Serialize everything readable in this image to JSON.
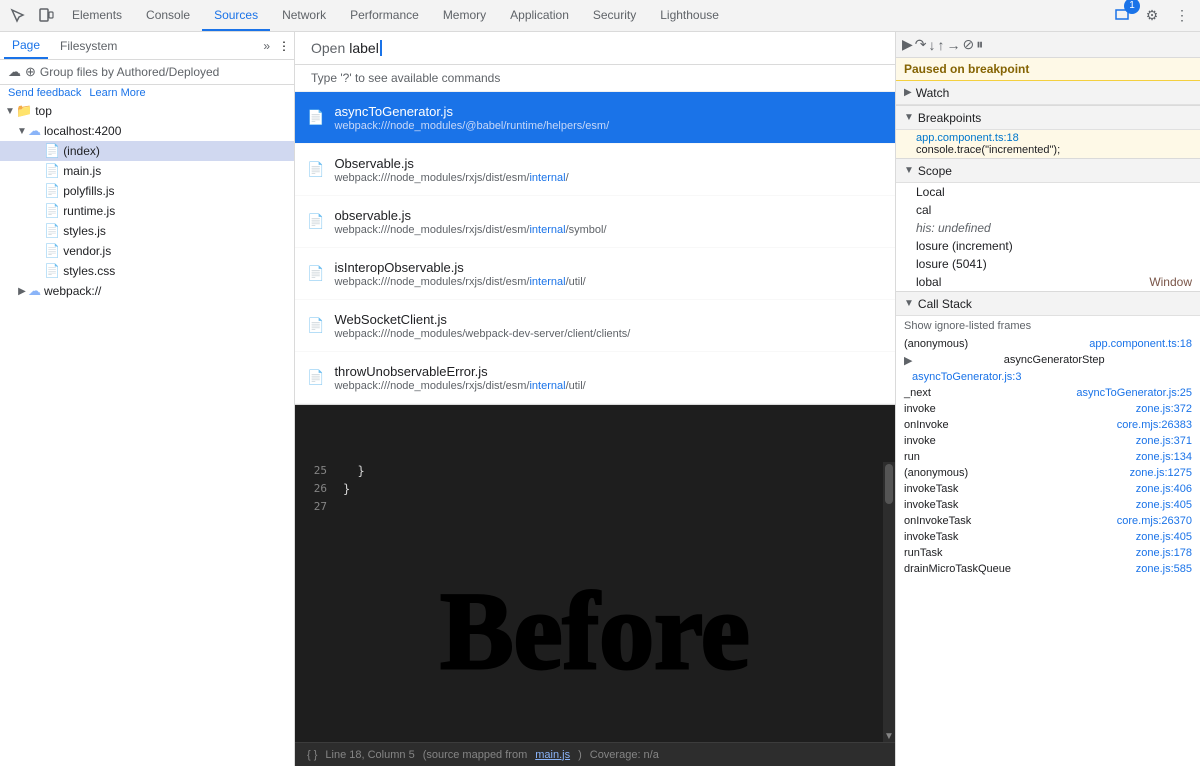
{
  "toolbar": {
    "tabs": [
      "Elements",
      "Console",
      "Sources",
      "Network",
      "Performance",
      "Memory",
      "Application",
      "Security",
      "Lighthouse"
    ],
    "activeTab": "Sources",
    "iconButtons": [
      "inspect",
      "device",
      "settings",
      "more"
    ],
    "badge": "1"
  },
  "leftPanel": {
    "subTabs": [
      "Page",
      "Filesystem"
    ],
    "activeSubTab": "Page",
    "groupLabel": "Group files by Authored/Deployed",
    "sendFeedback": "Send feedback",
    "learnMore": "Learn More",
    "tree": [
      {
        "level": 0,
        "type": "folder",
        "label": "top",
        "expanded": true
      },
      {
        "level": 1,
        "type": "cloud",
        "label": "localhost:4200",
        "expanded": true
      },
      {
        "level": 2,
        "type": "file",
        "label": "(index)",
        "selected": true
      },
      {
        "level": 2,
        "type": "js",
        "label": "main.js"
      },
      {
        "level": 2,
        "type": "js",
        "label": "polyfills.js"
      },
      {
        "level": 2,
        "type": "js",
        "label": "runtime.js"
      },
      {
        "level": 2,
        "type": "js",
        "label": "styles.js"
      },
      {
        "level": 2,
        "type": "js",
        "label": "vendor.js"
      },
      {
        "level": 2,
        "type": "css",
        "label": "styles.css"
      },
      {
        "level": 1,
        "type": "cloud",
        "label": "webpack://",
        "expanded": false
      }
    ]
  },
  "openFile": {
    "label": "Open",
    "query": "label",
    "hint": "Type '?' to see available commands",
    "results": [
      {
        "name": "asyncToGenerator.js",
        "path": "webpack:///node_modules/@babel/runtime/helpers/esm/",
        "pathHighlight": "",
        "active": true
      },
      {
        "name": "Observable.js",
        "path": "webpack:///node_modules/rxjs/dist/esm/internal/",
        "pathHighlight": "internal",
        "active": false
      },
      {
        "name": "observable.js",
        "path": "webpack:///node_modules/rxjs/dist/esm/internal/symbol/",
        "pathHighlight": "internal",
        "active": false
      },
      {
        "name": "isInteropObservable.js",
        "path": "webpack:///node_modules/rxjs/dist/esm/internal/util/",
        "pathHighlight": "internal",
        "active": false
      },
      {
        "name": "WebSocketClient.js",
        "path": "webpack:///node_modules/webpack-dev-server/client/clients/",
        "pathHighlight": "",
        "active": false
      },
      {
        "name": "throwUnobservableError.js",
        "path": "webpack:///node_modules/rxjs/dist/esm/internal/util/",
        "pathHighlight": "internal",
        "active": false
      }
    ]
  },
  "codeLines": [
    {
      "num": 25,
      "code": "  }"
    },
    {
      "num": 26,
      "code": "}"
    },
    {
      "num": 27,
      "code": ""
    }
  ],
  "bottomBar": {
    "braces": "{ }",
    "position": "Line 18, Column 5",
    "sourceMap": "(source mapped from",
    "sourceFile": "main.js",
    "coverage": "Coverage: n/a"
  },
  "rightPanel": {
    "pausedBanner": "Paused on breakpoint",
    "watchLabel": "Watch",
    "breakpointsLabel": "Breakpoints",
    "breakpointFile": "app.component.ts:18",
    "breakpointCode": "console.trace(\"incremented\");",
    "scopeLabel": "Scope",
    "scopeItems": [
      {
        "key": "Local",
        "value": ""
      },
      {
        "key": "cal",
        "value": ""
      },
      {
        "key": "his: undefined",
        "value": ""
      },
      {
        "key": "losure (increment)",
        "value": ""
      },
      {
        "key": "losure (5041)",
        "value": ""
      },
      {
        "key": "lobal",
        "value": "Window"
      }
    ],
    "callStackLabel": "Call Stack",
    "showIgnored": "Show ignore-listed frames",
    "callStack": [
      {
        "name": "(anonymous)",
        "location": "app.component.ts:18",
        "indent": false,
        "active": false
      },
      {
        "name": "▶ asyncGeneratorStep",
        "location": "",
        "indent": false,
        "active": false
      },
      {
        "name": "",
        "location": "asyncToGenerator.js:3",
        "indent": true,
        "active": false
      },
      {
        "name": "_next",
        "location": "asyncToGenerator.js:25",
        "indent": false,
        "active": false
      },
      {
        "name": "invoke",
        "location": "zone.js:372",
        "indent": false,
        "active": false
      },
      {
        "name": "onInvoke",
        "location": "core.mjs:26383",
        "indent": false,
        "active": false
      },
      {
        "name": "invoke",
        "location": "zone.js:371",
        "indent": false,
        "active": false
      },
      {
        "name": "run",
        "location": "zone.js:134",
        "indent": false,
        "active": false
      },
      {
        "name": "(anonymous)",
        "location": "zone.js:1275",
        "indent": false,
        "active": false
      },
      {
        "name": "invokeTask",
        "location": "zone.js:406",
        "indent": false,
        "active": false
      },
      {
        "name": "invokeTask",
        "location": "zone.js:405",
        "indent": false,
        "active": false
      },
      {
        "name": "onInvokeTask",
        "location": "core.mjs:26370",
        "indent": false,
        "active": false
      },
      {
        "name": "invokeTask",
        "location": "zone.js:405",
        "indent": false,
        "active": false
      },
      {
        "name": "runTask",
        "location": "zone.js:178",
        "indent": false,
        "active": false
      },
      {
        "name": "drainMicroTaskQueue",
        "location": "zone.js:585",
        "indent": false,
        "active": false
      }
    ]
  },
  "bigText": "Before"
}
